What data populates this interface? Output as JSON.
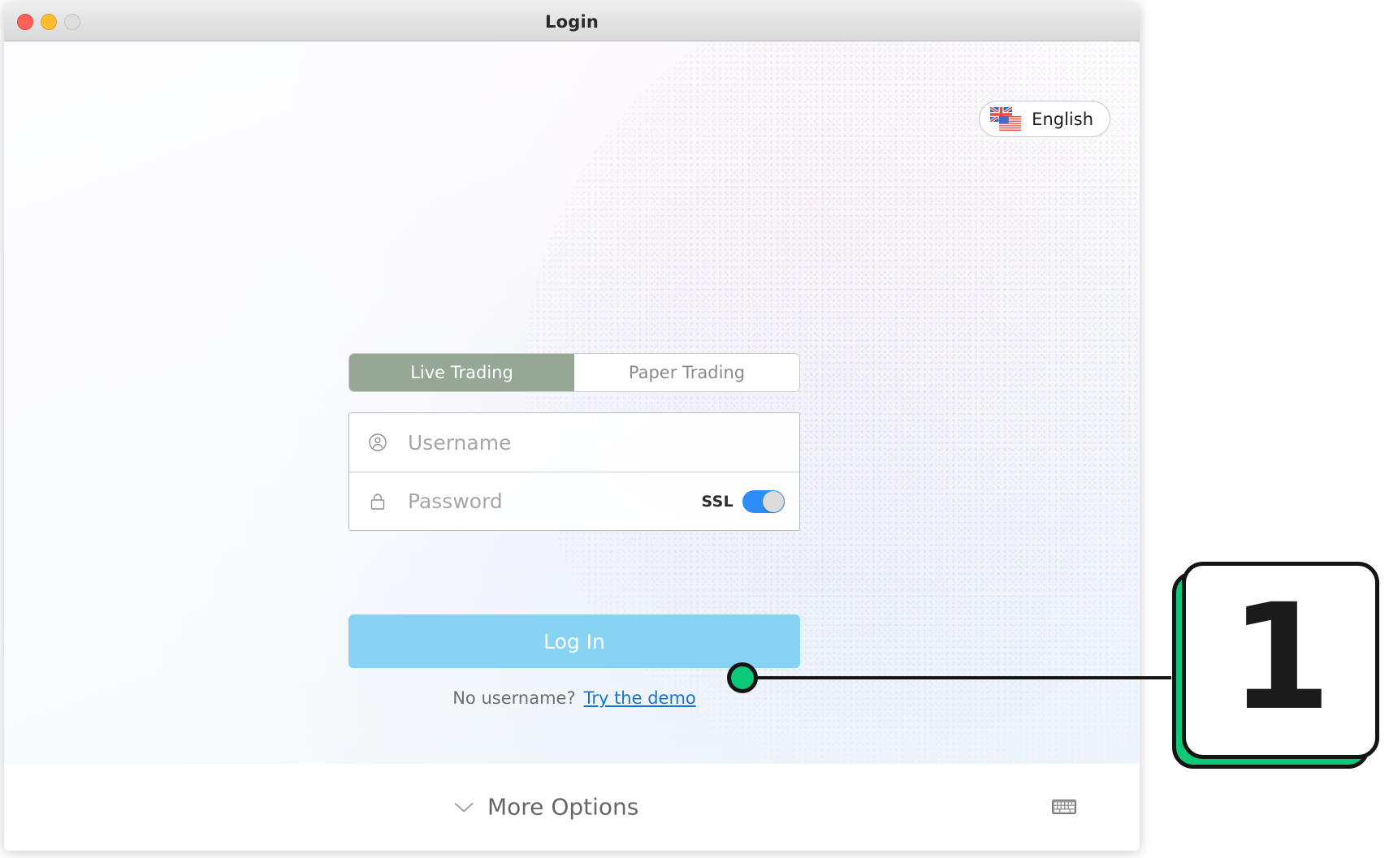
{
  "window": {
    "title": "Login",
    "traffic_lights": [
      {
        "name": "close",
        "color": "#ff6058"
      },
      {
        "name": "minimize",
        "color": "#ffbd2e"
      },
      {
        "name": "zoom",
        "color": "#dedede"
      }
    ]
  },
  "language": {
    "label": "English",
    "icon": "uk-us-flag-icon"
  },
  "tabs": [
    {
      "label": "Live Trading",
      "active": true
    },
    {
      "label": "Paper Trading",
      "active": false
    }
  ],
  "form": {
    "username": {
      "placeholder": "Username",
      "value": "",
      "icon": "user-circle-icon"
    },
    "password": {
      "placeholder": "Password",
      "value": "",
      "icon": "lock-icon"
    },
    "ssl": {
      "label": "SSL",
      "enabled": true,
      "on_color": "#2e8cf6",
      "knob_color": "#dcdcdc"
    },
    "login_button": {
      "label": "Log In",
      "color": "#87d3f3"
    },
    "demo": {
      "question": "No username?",
      "link_label": "Try the demo",
      "link_color": "#1a73c8"
    }
  },
  "footer": {
    "more_options_label": "More Options",
    "more_options_icon": "chevron-down-icon",
    "keyboard_icon": "keyboard-icon"
  },
  "annotation": {
    "step_number": "1",
    "accent_color": "#0ec87a",
    "outline_color": "#141414"
  },
  "colors": {
    "tab_active_bg": "#96a795",
    "login_button": "#87d3f3",
    "link": "#1a73c8",
    "toggle_on": "#2e8cf6",
    "annotation_green": "#0ec87a"
  }
}
